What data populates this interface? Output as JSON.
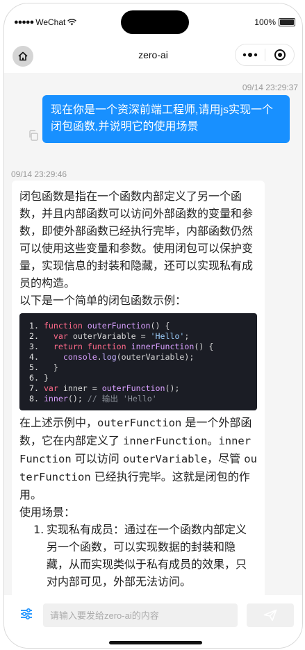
{
  "status_bar": {
    "carrier": "WeChat",
    "battery": "100%"
  },
  "nav": {
    "title": "zero-ai"
  },
  "messages": {
    "user": {
      "time": "09/14 23:29:37",
      "text": "现在你是一个资深前端工程师,请用js实现一个闭包函数,并说明它的使用场景"
    },
    "ai": {
      "time": "09/14 23:29:46",
      "intro": "闭包函数是指在一个函数内部定义了另一个函数，并且内部函数可以访问外部函数的变量和参数，即使外部函数已经执行完毕，内部函数仍然可以使用这些变量和参数。使用闭包可以保护变量，实现信息的封装和隐藏，还可以实现私有成员的构造。",
      "example_intro": "以下是一个简单的闭包函数示例：",
      "code_lines": [
        "1.",
        "2.",
        "3.",
        "4.",
        "5.",
        "6.",
        "7.",
        "8."
      ],
      "code": {
        "l1_kw": "function",
        "l1_fn": "outerFunction",
        "l1_rest": "() {",
        "l2_kw": "var",
        "l2_mid": " outerVariable = ",
        "l2_str": "'Hello'",
        "l2_end": ";",
        "l3_kw1": "return",
        "l3_kw2": "function",
        "l3_fn": "innerFunction",
        "l3_rest": "() {",
        "l4_fn": "console",
        "l4_dot": ".",
        "l4_prop": "log",
        "l4_rest": "(outerVariable);",
        "l5": "}",
        "l6": "}",
        "l7_kw": "var",
        "l7_mid": " inner = ",
        "l7_fn": "outerFunction",
        "l7_rest": "();",
        "l8_fn": "inner",
        "l8_rest": "(); ",
        "l8_cm": "// 输出 'Hello'"
      },
      "explain": {
        "p1": "在上述示例中，",
        "outer1": "outerFunction",
        "p2": " 是一个外部函数，它在内部定义了 ",
        "inner1": "innerFunction",
        "p3": "。",
        "inner2": "innerFunction",
        "p4": " 可以访问 ",
        "var1": "outerVariable",
        "p5": "，尽管 ",
        "outer2": "outerFunction",
        "p6": " 已经执行完毕。这就是闭包的作用。"
      },
      "usage_title": "使用场景：",
      "usage_items": [
        {
          "num": "1.",
          "text": "实现私有成员：通过在一个函数内部定义另一个函数，可以实现数据的封装和隐藏，从而实现类似于私有成员的效果，只对内部可见，外部无法访问。"
        }
      ]
    }
  },
  "input": {
    "placeholder": "请输入要发给zero-ai的内容",
    "value": ""
  },
  "colors": {
    "accent": "#1890ff",
    "code_bg": "#1b1d25"
  }
}
